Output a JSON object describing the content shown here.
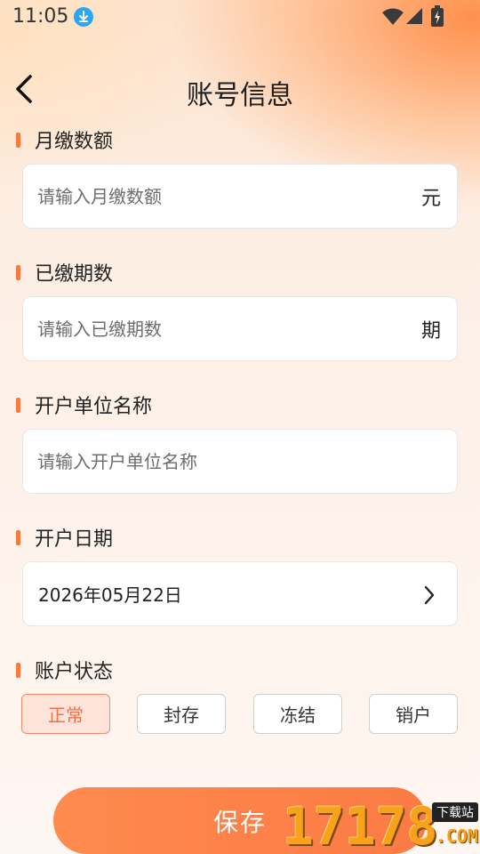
{
  "status_bar": {
    "time": "11:05",
    "icons": [
      "download-icon",
      "wifi-icon",
      "signal-icon",
      "battery-charging-icon"
    ]
  },
  "header": {
    "back_icon": "chevron-left-icon",
    "title": "账号信息"
  },
  "form": {
    "monthly_payment": {
      "label": "月缴数额",
      "placeholder": "请输入月缴数额",
      "value": "",
      "unit": "元"
    },
    "paid_periods": {
      "label": "已缴期数",
      "placeholder": "请输入已缴期数",
      "value": "",
      "unit": "期"
    },
    "account_unit_name": {
      "label": "开户单位名称",
      "placeholder": "请输入开户单位名称",
      "value": ""
    },
    "open_date": {
      "label": "开户日期",
      "value": "2026年05月22日",
      "icon": "chevron-right-icon"
    },
    "account_status": {
      "label": "账户状态",
      "options": [
        "正常",
        "封存",
        "冻结",
        "销户"
      ],
      "selected": "正常"
    }
  },
  "actions": {
    "save_label": "保存"
  },
  "watermark": {
    "digits": "17178",
    "tag": "下载站",
    "suffix": ".COM"
  },
  "colors": {
    "accent": "#f9793f",
    "save_button": "#fb7a45",
    "selected_option_bg": "#fde3d9",
    "selected_option_text": "#f36f4a"
  }
}
